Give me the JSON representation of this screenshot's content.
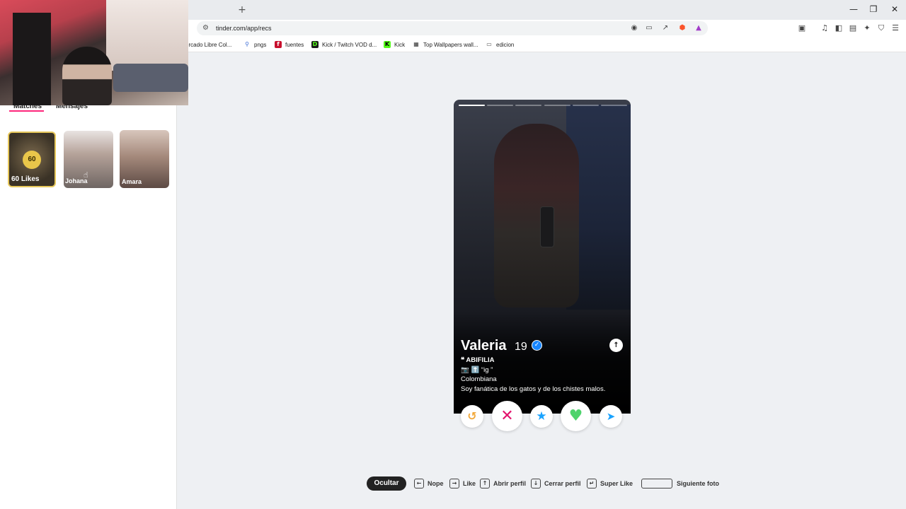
{
  "browser": {
    "new_tab": "+",
    "url": "tinder.com/app/recs",
    "window_controls": {
      "minimize": "—",
      "restore": "❐",
      "close": "✕"
    },
    "bookmarks": [
      {
        "label": "ercado Libre Col...",
        "icon": "mercadolibre-icon"
      },
      {
        "label": "pngs",
        "icon": "pin-icon"
      },
      {
        "label": "fuentes",
        "icon": "font-icon"
      },
      {
        "label": "Kick / Twitch VOD d...",
        "icon": "kick-dl-icon"
      },
      {
        "label": "Kick",
        "icon": "kick-icon"
      },
      {
        "label": "Top Wallpapers wall...",
        "icon": "wallpaper-icon"
      },
      {
        "label": "edicion",
        "icon": "folder-icon"
      }
    ]
  },
  "sidebar": {
    "tabs": [
      {
        "label": "Matches",
        "active": true
      },
      {
        "label": "Mensajes",
        "active": false
      }
    ],
    "likes_card": {
      "count": "60",
      "label": "60 Likes"
    },
    "matches": [
      {
        "name": "Johana"
      },
      {
        "name": "Amara"
      }
    ]
  },
  "profile": {
    "name": "Valeria",
    "age": "19",
    "verified": true,
    "photo_count": 6,
    "active_photo": 1,
    "bio": [
      "❝ ABIFILIA",
      "📷 ⬆️ “ig ”",
      "Colombiana",
      "Soy fanática de los gatos y de los chistes malos."
    ]
  },
  "actions": {
    "rewind": "↺",
    "nope": "✕",
    "super_like": "★",
    "like": "♥",
    "boost": "➤"
  },
  "shortcuts": {
    "hide_label": "Ocultar",
    "items": [
      {
        "key": "←",
        "label": "Nope"
      },
      {
        "key": "→",
        "label": "Like"
      },
      {
        "key": "↑",
        "label": "Abrir perfil"
      },
      {
        "key": "↓",
        "label": "Cerrar perfil"
      },
      {
        "key": "↵",
        "label": "Super Like"
      },
      {
        "key": "",
        "label": "Siguiente foto"
      }
    ]
  },
  "colors": {
    "brand_pink": "#fd267a",
    "nope_red": "#e3136c",
    "like_green": "#4ed36c",
    "super_blue": "#1aa3ff",
    "rewind_orange": "#f2a93b",
    "likes_gold": "#e9c64a"
  }
}
